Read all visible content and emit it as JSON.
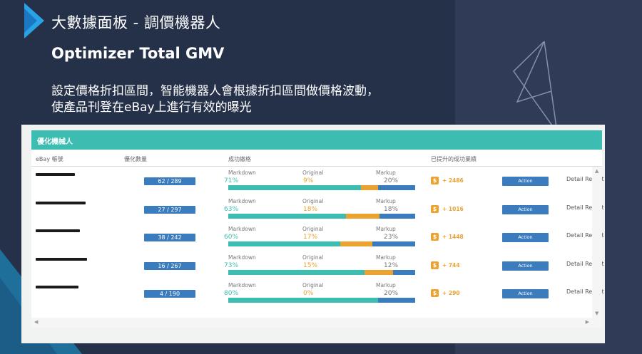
{
  "slide": {
    "title": "大數據面板 - 調價機器人",
    "subtitle": "Optimizer Total GMV",
    "description_line1": "設定價格折扣區間，智能機器人會根據折扣區間做價格波動，",
    "description_line2": "使產品刊登在eBay上進行有效的曝光"
  },
  "app": {
    "header_title": "優化機械人",
    "columns": [
      "eBay 帳號",
      "優化數量",
      "成功繳格",
      "已提升的成功業績"
    ],
    "labels": {
      "markdown": "Markdown",
      "original": "Original",
      "markup": "Markup"
    },
    "rows": [
      {
        "count": "62 / 289",
        "markdown": "71%",
        "original": "9%",
        "markup": "20%",
        "gain": "+ 2486",
        "action": "Action",
        "detail": "Detail Report",
        "md": 71,
        "or": 9
      },
      {
        "count": "27 / 297",
        "markdown": "63%",
        "original": "18%",
        "markup": "18%",
        "gain": "+ 1016",
        "action": "Action",
        "detail": "Detail Report",
        "md": 63,
        "or": 18
      },
      {
        "count": "38 / 242",
        "markdown": "60%",
        "original": "17%",
        "markup": "23%",
        "gain": "+ 1448",
        "action": "Action",
        "detail": "Detail Report",
        "md": 60,
        "or": 17
      },
      {
        "count": "16 / 267",
        "markdown": "73%",
        "original": "15%",
        "markup": "12%",
        "gain": "+ 744",
        "action": "Action",
        "detail": "Detail Report",
        "md": 73,
        "or": 15
      },
      {
        "count": "4 / 190",
        "markdown": "80%",
        "original": "0%",
        "markup": "20%",
        "gain": "+ 290",
        "action": "Action",
        "detail": "Detail Report",
        "md": 80,
        "or": 0
      }
    ]
  },
  "colors": {
    "teal": "#3dbdb2",
    "blue": "#3b7cbf",
    "orange": "#eba22e",
    "slide_bg": "#253049"
  },
  "icons": {
    "logo": "blue-play-logo-icon",
    "dollar": "dollar-icon",
    "decor": "triangle-outline-icon"
  }
}
